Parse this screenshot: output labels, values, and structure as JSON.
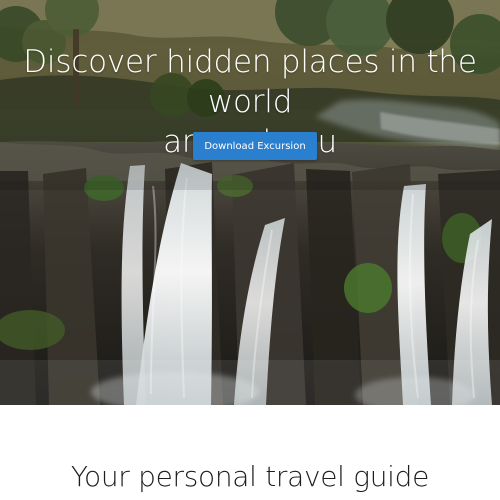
{
  "hero": {
    "headline_line_1": "Discover hidden places in the world",
    "headline_line_2": "around you",
    "cta_label": "Download Excursion",
    "accent_color": "#2b7fcf",
    "background_scene": "waterfall-cliffs"
  },
  "section": {
    "title": "Your personal travel guide"
  }
}
